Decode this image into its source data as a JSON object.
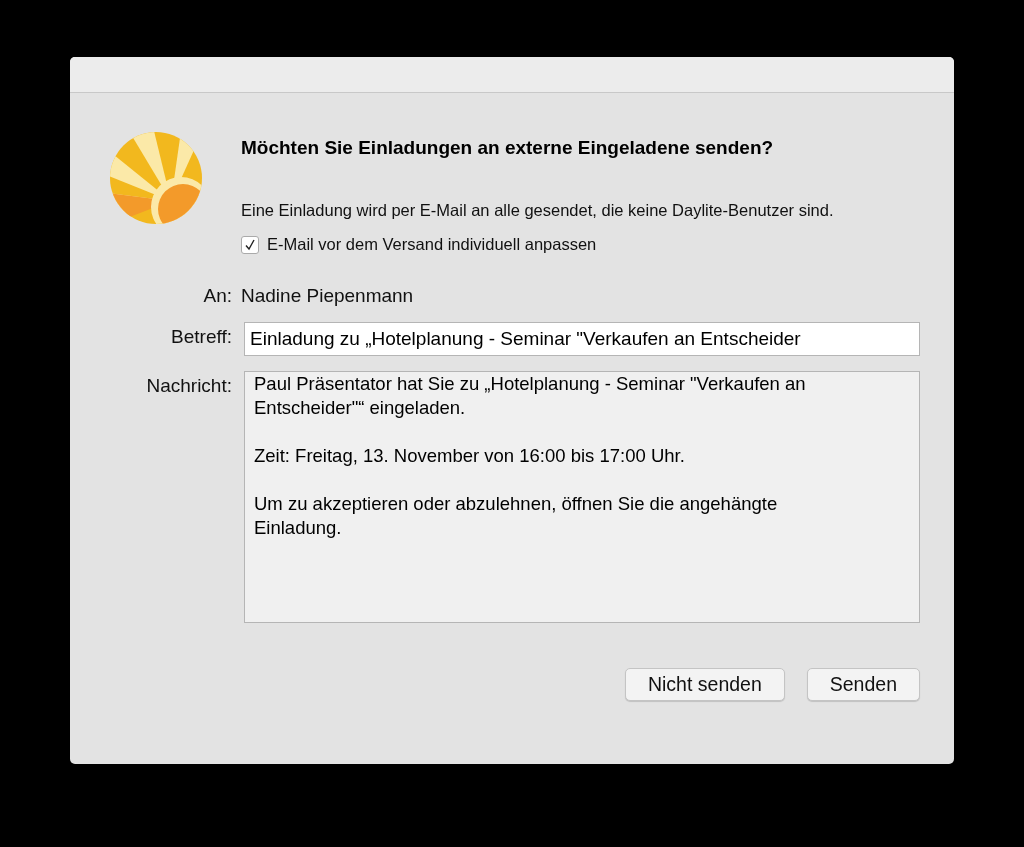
{
  "dialog": {
    "title": "Möchten Sie Einladungen an externe Eingeladene senden?",
    "description": "Eine Einladung wird per E-Mail an alle gesendet, die keine Daylite-Benutzer sind.",
    "option": {
      "label": "E-Mail vor dem Versand individuell anpassen",
      "checked": true
    },
    "fields": [
      {
        "kind": "text",
        "label": "An:",
        "value": "Nadine Piepenmann"
      },
      {
        "kind": "input",
        "label": "Betreff:",
        "value": "Einladung zu „Hotelplanung - Seminar \"Verkaufen an Entscheider"
      },
      {
        "kind": "textarea",
        "label": "Nachricht:",
        "value": "Paul Präsentator hat Sie zu „Hotelplanung - Seminar \"Verkaufen an Entscheider\"“ eingeladen.\n\nZeit: Freitag, 13. November von 16:00 bis 17:00 Uhr.\n\nUm zu akzeptieren oder abzulehnen, öffnen Sie die angehängte Einladung."
      }
    ],
    "buttons": [
      "Nicht senden",
      "Senden"
    ]
  }
}
